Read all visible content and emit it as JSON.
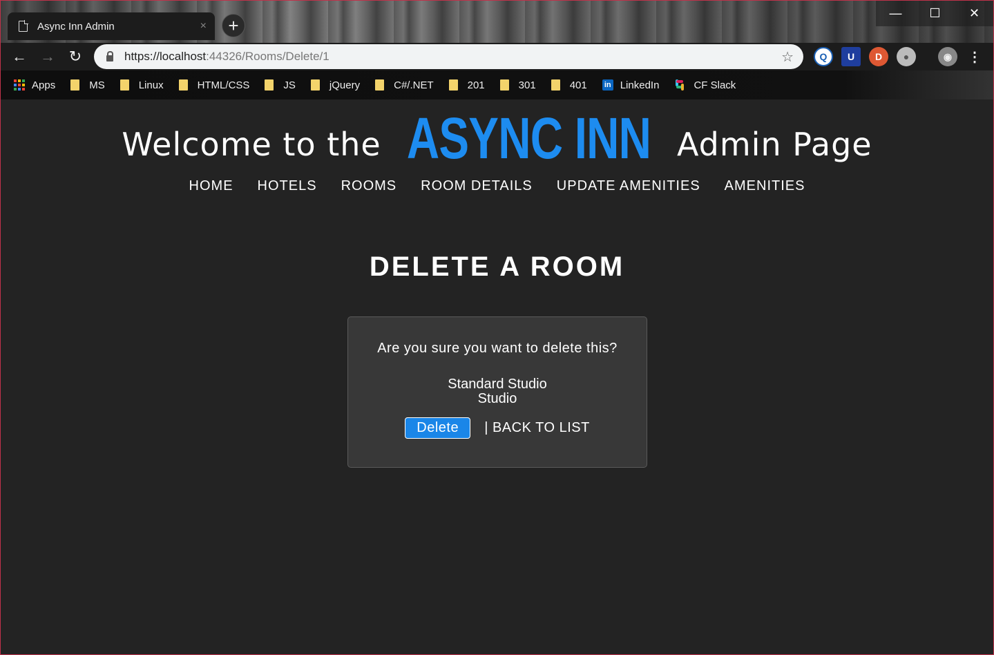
{
  "browser": {
    "tab_title": "Async Inn Admin",
    "tab_close": "×",
    "new_tab": "+",
    "url_host": "https://localhost",
    "url_rest": ":44326/Rooms/Delete/1",
    "window_controls": {
      "minimize": "—",
      "maximize": "☐",
      "close": "✕"
    },
    "nav": {
      "back": "←",
      "forward": "→",
      "reload": "↻"
    },
    "bookmarks": [
      {
        "label": "Apps",
        "icon": "apps-icon"
      },
      {
        "label": "MS",
        "icon": "folder-icon"
      },
      {
        "label": "Linux",
        "icon": "folder-icon"
      },
      {
        "label": "HTML/CSS",
        "icon": "folder-icon"
      },
      {
        "label": "JS",
        "icon": "folder-icon"
      },
      {
        "label": "jQuery",
        "icon": "folder-icon"
      },
      {
        "label": "C#/.NET",
        "icon": "folder-icon"
      },
      {
        "label": "201",
        "icon": "folder-icon"
      },
      {
        "label": "301",
        "icon": "folder-icon"
      },
      {
        "label": "401",
        "icon": "folder-icon"
      },
      {
        "label": "LinkedIn",
        "icon": "linkedin-icon"
      },
      {
        "label": "CF Slack",
        "icon": "slack-icon"
      }
    ]
  },
  "site": {
    "title_prefix": "Welcome to the ",
    "brand": "ASYNC INN",
    "title_suffix": " Admin Page",
    "brand_color": "#1d8cf0",
    "nav": [
      "HOME",
      "HOTELS",
      "ROOMS",
      "ROOM DETAILS",
      "UPDATE AMENITIES",
      "AMENITIES"
    ]
  },
  "main": {
    "heading": "DELETE A ROOM",
    "question": "Are you sure you want to delete this?",
    "room_name": "Standard Studio",
    "room_layout": "Studio",
    "delete_label": "Delete",
    "back_label": "| BACK TO LIST"
  }
}
